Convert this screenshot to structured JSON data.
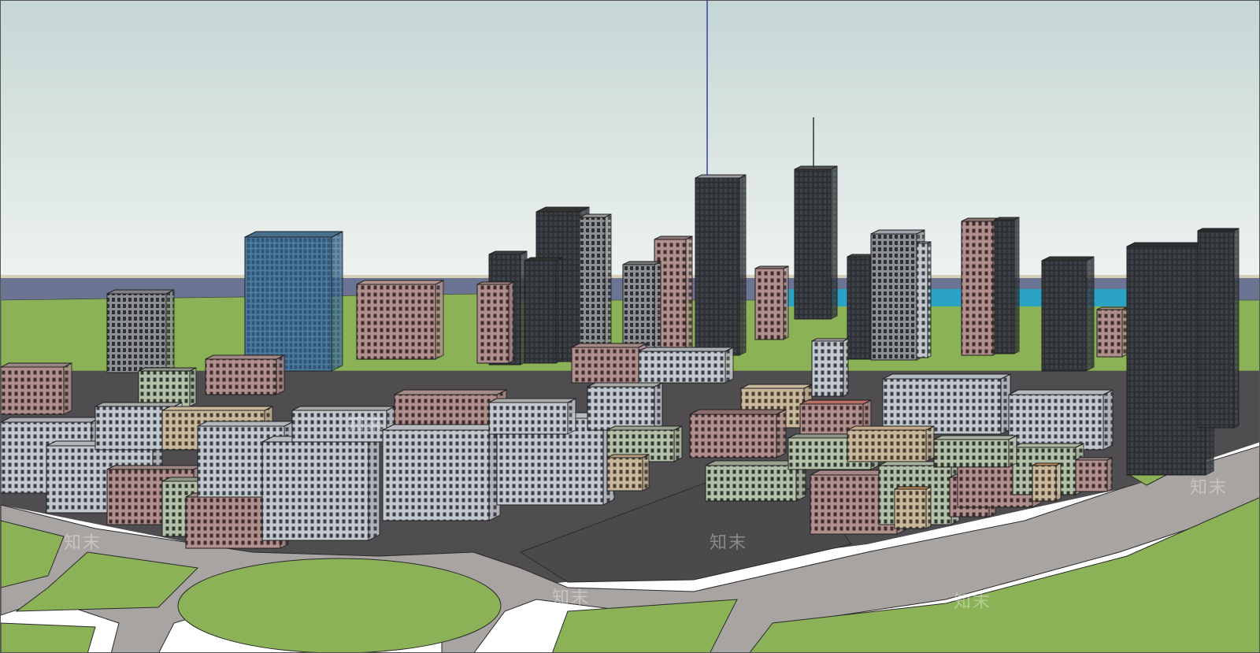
{
  "scene": {
    "description_kind": "3d-city-model-render",
    "colors": {
      "sky_top": "#c9dad8",
      "sky_bottom": "#e9f1ef",
      "water": "#6b7593",
      "grass": "#8bb257",
      "road": "#a8a4a2",
      "asphalt": "#4f4d50",
      "outline": "#222222",
      "glass_blue": "#3f6c8f",
      "glass_dark": "#2c2f33",
      "brick_pink": "#a98482",
      "concrete_light": "#b8bdc4",
      "sand": "#c5b49a"
    }
  },
  "watermarks": [
    "知末",
    "知末",
    "知末",
    "知末",
    "知末",
    "知末"
  ]
}
